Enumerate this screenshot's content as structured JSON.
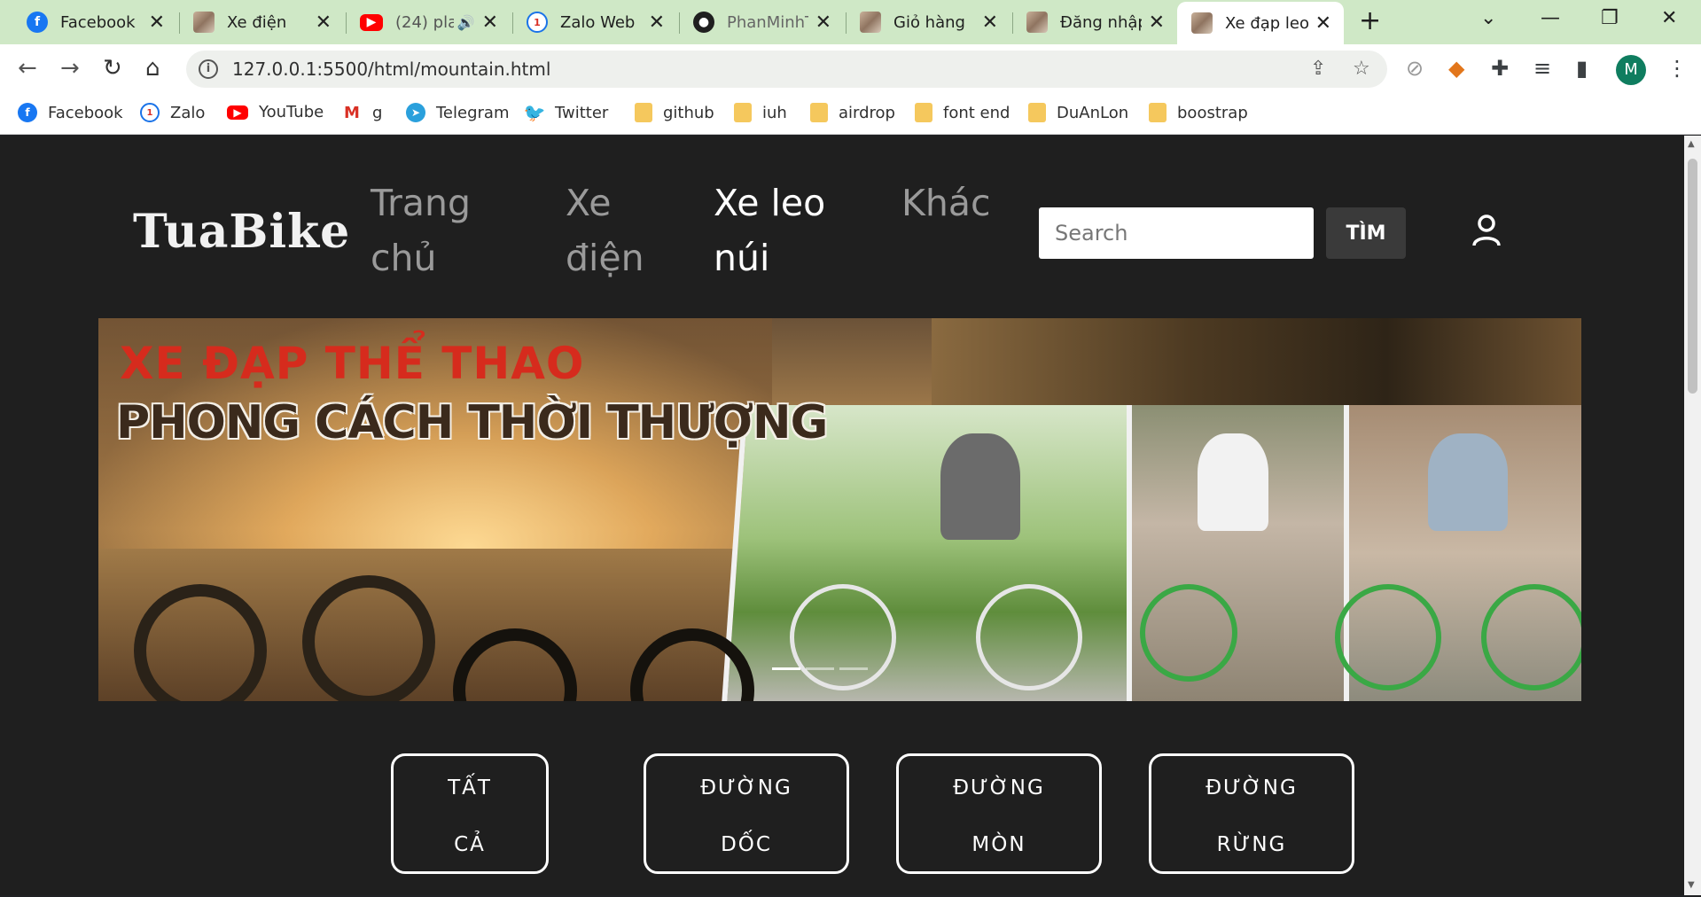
{
  "browser": {
    "tabs": [
      {
        "title": "Facebook",
        "icon": "facebook-icon",
        "active": false
      },
      {
        "title": "Xe điện",
        "icon": "site-favicon",
        "active": false
      },
      {
        "title": "(24) pla",
        "icon": "youtube-icon",
        "active": false
      },
      {
        "title": "Zalo Web",
        "icon": "zalo-icon",
        "active": false
      },
      {
        "title": "PhanMinhT",
        "icon": "github-icon",
        "active": false
      },
      {
        "title": "Giỏ hàng",
        "icon": "site-favicon",
        "active": false
      },
      {
        "title": "Đăng nhập",
        "icon": "site-favicon",
        "active": false
      },
      {
        "title": "Xe đạp leo",
        "icon": "site-favicon",
        "active": true
      }
    ],
    "url": "127.0.0.1:5500/html/mountain.html",
    "profile_initial": "M",
    "bookmarks": [
      {
        "label": "Facebook",
        "icon": "facebook-icon"
      },
      {
        "label": "Zalo",
        "icon": "zalo-icon"
      },
      {
        "label": "YouTube",
        "icon": "youtube-icon"
      },
      {
        "label": "g",
        "icon": "gmail-icon"
      },
      {
        "label": "Telegram",
        "icon": "telegram-icon"
      },
      {
        "label": "Twitter",
        "icon": "twitter-icon"
      },
      {
        "label": "github",
        "icon": "folder-icon"
      },
      {
        "label": "iuh",
        "icon": "folder-icon"
      },
      {
        "label": "airdrop",
        "icon": "folder-icon"
      },
      {
        "label": "font end",
        "icon": "folder-icon"
      },
      {
        "label": "DuAnLon",
        "icon": "folder-icon"
      },
      {
        "label": "boostrap",
        "icon": "folder-icon"
      }
    ]
  },
  "site": {
    "logo": "TuaBike",
    "nav": [
      {
        "line1": "Trang",
        "line2": "chủ",
        "active": false
      },
      {
        "line1": "Xe",
        "line2": "điện",
        "active": false
      },
      {
        "line1": "Xe leo",
        "line2": "núi",
        "active": true
      },
      {
        "line1": "Khác",
        "line2": "",
        "active": false
      }
    ],
    "search_placeholder": "Search",
    "search_button": "TÌM",
    "banner": {
      "headline": "XE ĐẠP THỂ THAO",
      "subheadline": "PHONG CÁCH THỜI THƯỢNG"
    },
    "filters": [
      {
        "line1": "TẤT",
        "line2": "CẢ"
      },
      {
        "line1": "ĐƯỜNG",
        "line2": "DỐC"
      },
      {
        "line1": "ĐƯỜNG",
        "line2": "MÒN"
      },
      {
        "line1": "ĐƯỜNG",
        "line2": "RỪNG"
      }
    ]
  },
  "colors": {
    "tabstrip": "#cfe8c6",
    "page_bg": "#1f1f1f",
    "headline_red": "#d62b1d",
    "search_button_bg": "#3a3a3a"
  }
}
